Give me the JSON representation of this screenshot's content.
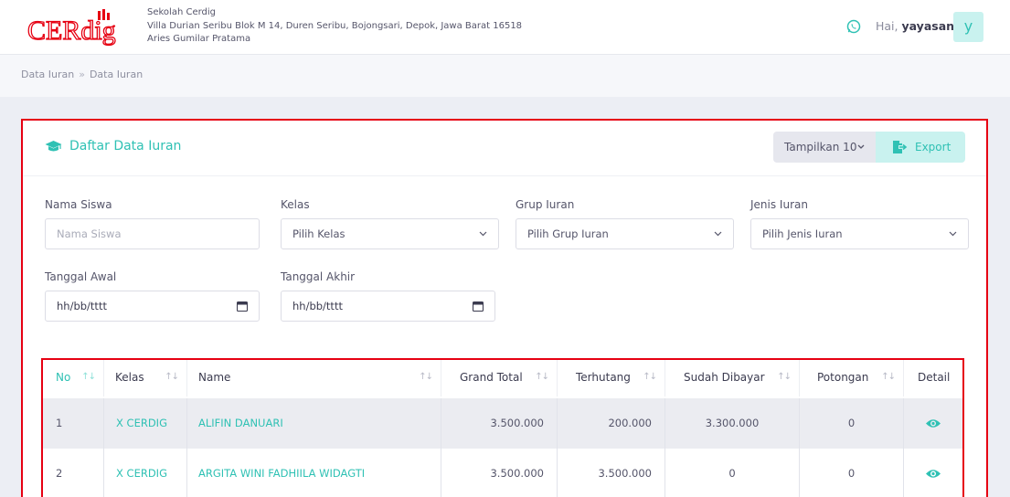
{
  "brand": {
    "logo_text": "CERdig",
    "accent": "#e60012",
    "teal": "#2fc1b4"
  },
  "header": {
    "school_name": "Sekolah Cerdig",
    "school_address": "Villa Durian Seribu Blok M 14, Duren Seribu, Bojongsari, Depok, Jawa Barat 16518",
    "school_head": "Aries Gumilar Pratama",
    "greeting_prefix": "Hai, ",
    "username": "yayasan",
    "avatar_letter": "y",
    "whatsapp_icon": "whatsapp-icon"
  },
  "breadcrumb": {
    "items": [
      "Data Iuran",
      "Data Iuran"
    ],
    "separator": "»"
  },
  "card": {
    "title": "Daftar Data Iuran",
    "title_icon": "graduation-cap-icon",
    "show_label": "Tampilkan 10",
    "export_label": "Export"
  },
  "filters": {
    "nama_siswa": {
      "label": "Nama Siswa",
      "placeholder": "Nama Siswa",
      "value": ""
    },
    "kelas": {
      "label": "Kelas",
      "value": "Pilih Kelas"
    },
    "grup_iuran": {
      "label": "Grup Iuran",
      "value": "Pilih Grup Iuran"
    },
    "jenis_iuran": {
      "label": "Jenis Iuran",
      "value": "Pilih Jenis Iuran"
    },
    "tanggal_awal": {
      "label": "Tanggal Awal",
      "value": "hh/bb/tttt"
    },
    "tanggal_akhir": {
      "label": "Tanggal Akhir",
      "value": "hh/bb/tttt"
    }
  },
  "table": {
    "columns": [
      "No",
      "Kelas",
      "Name",
      "Grand Total",
      "Terhutang",
      "Sudah Dibayar",
      "Potongan",
      "Detail"
    ],
    "rows": [
      {
        "no": "1",
        "kelas": "X CERDIG",
        "name": "ALIFIN DANUARI",
        "grand_total": "3.500.000",
        "terhutang": "200.000",
        "sudah_dibayar": "3.300.000",
        "potongan": "0"
      },
      {
        "no": "2",
        "kelas": "X CERDIG",
        "name": "ARGITA WINI FADHIILA WIDAGTI",
        "grand_total": "3.500.000",
        "terhutang": "3.500.000",
        "sudah_dibayar": "0",
        "potongan": "0"
      }
    ]
  }
}
